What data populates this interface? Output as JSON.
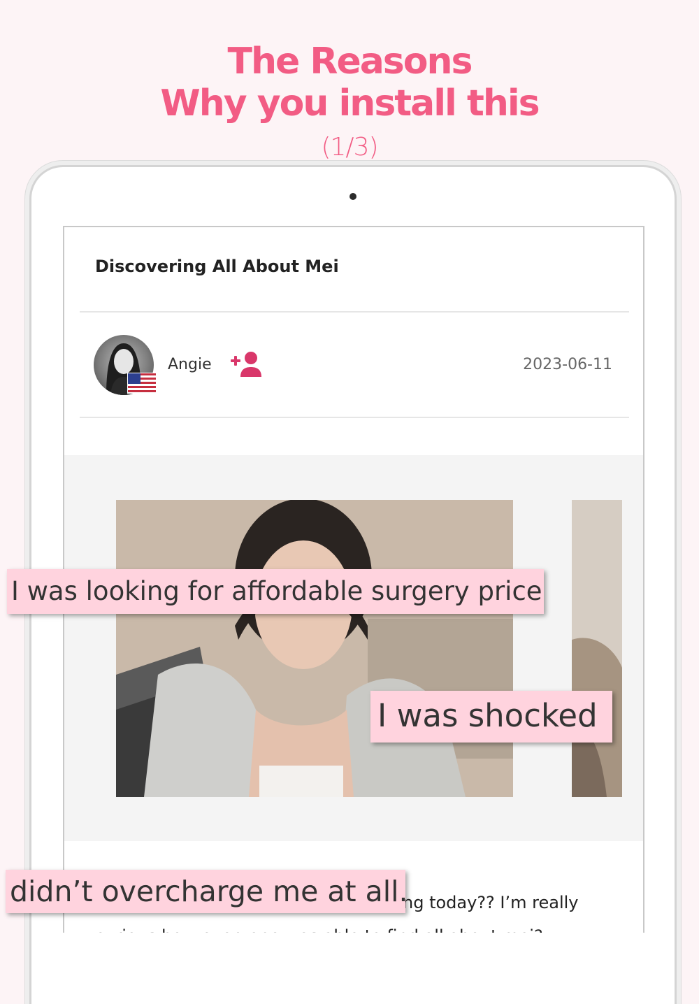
{
  "headline": {
    "line1": "The Reasons",
    "line2": "Why you install this",
    "counter": "(1/3)"
  },
  "post": {
    "title": "Discovering All About Mei",
    "author": "Angie",
    "country_flag": "us-flag-icon",
    "follow_icon": "add-user-icon",
    "date": "2023-06-11",
    "body_visible_line1": "ng today?? I’m really",
    "body_visible_line2": "curious how everyone was able to find all about mei?"
  },
  "captions": {
    "caption1": "I was looking for affordable surgery price",
    "caption2": "I was shocked",
    "caption3": "didn’t overcharge me at all."
  },
  "colors": {
    "accent_pink": "#f25c84",
    "caption_bg": "#ffd3de",
    "follow_icon": "#d9376a"
  }
}
